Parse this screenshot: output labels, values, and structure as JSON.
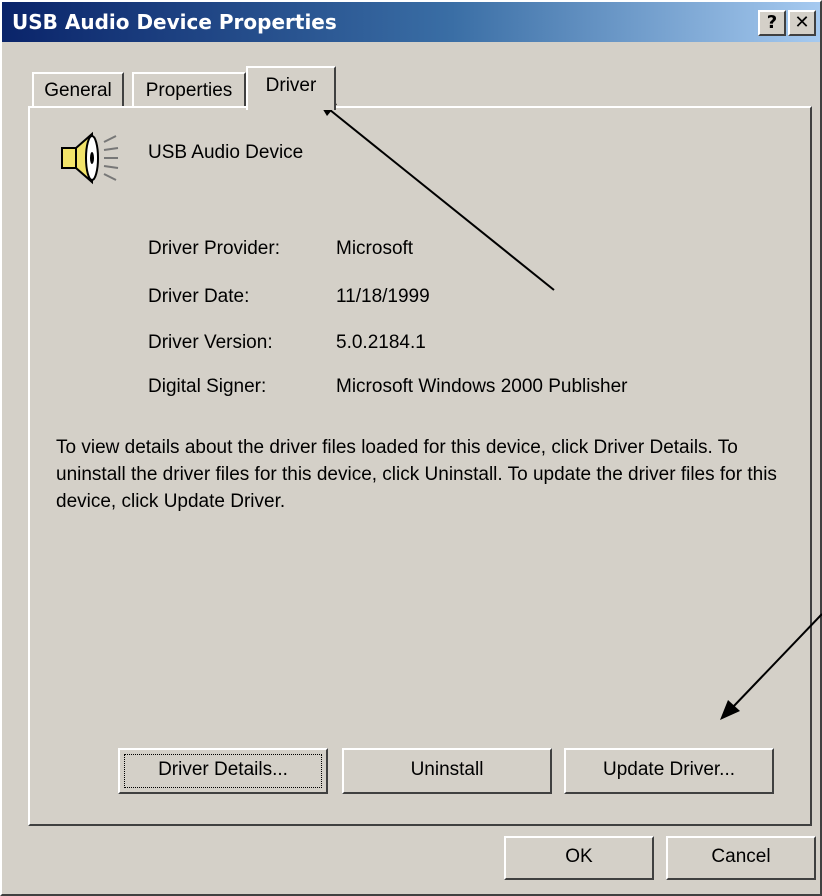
{
  "window": {
    "title": "USB Audio Device Properties",
    "help_glyph": "?",
    "close_glyph": "✕"
  },
  "tabs": [
    {
      "label": "General"
    },
    {
      "label": "Properties"
    },
    {
      "label": "Driver"
    }
  ],
  "device": {
    "name": "USB Audio Device",
    "icon": "speaker-icon"
  },
  "driver_info": [
    {
      "label": "Driver Provider:",
      "value": "Microsoft"
    },
    {
      "label": "Driver Date:",
      "value": "11/18/1999"
    },
    {
      "label": "Driver Version:",
      "value": "5.0.2184.1"
    },
    {
      "label": "Digital Signer:",
      "value": "Microsoft Windows 2000 Publisher"
    }
  ],
  "description": "To view details about the driver files loaded for this device, click Driver Details. To uninstall the driver files for this device, click Uninstall. To update the driver files for this device, click Update Driver.",
  "buttons": {
    "driver_details": "Driver Details...",
    "uninstall": "Uninstall",
    "update_driver": "Update Driver...",
    "ok": "OK",
    "cancel": "Cancel"
  }
}
